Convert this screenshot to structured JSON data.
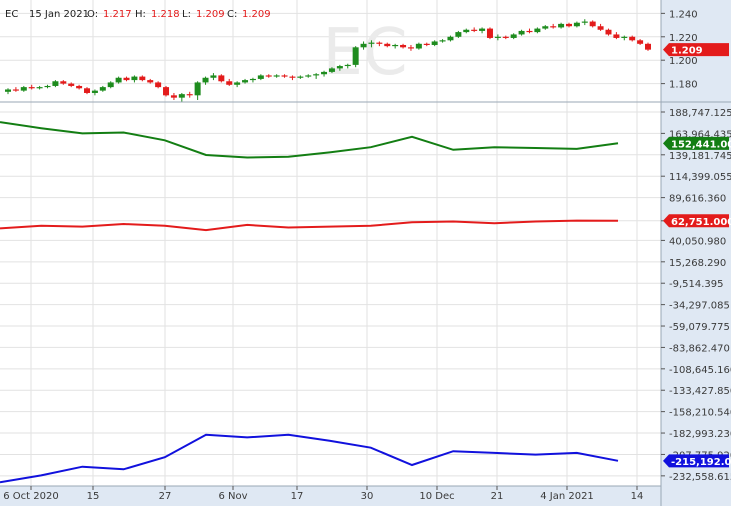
{
  "header": {
    "symbol": "EC",
    "date": "15 Jan 2021",
    "o_label": "O:",
    "o_value": "1.217",
    "h_label": "H:",
    "h_value": "1.218",
    "l_label": "L:",
    "l_value": "1.209",
    "c_label": "C:",
    "c_value": "1.209"
  },
  "watermark": "EC",
  "colors": {
    "up": "#1e8c1e",
    "down": "#e31b1b",
    "cot_commercial": "#137e13",
    "cot_noncommercial": "#e31b1b",
    "cot_small": "#1111dd",
    "axis_panel": "#dfe8f3",
    "grid": "#e2e2e2",
    "border": "#9aa7b5"
  },
  "chart_data": [
    {
      "type": "candlestick",
      "title": "EC",
      "ylim": [
        1.166,
        1.248
      ],
      "y_ticks": [
        "1.240",
        "1.220",
        "1.200",
        "1.180"
      ],
      "last_value_label": "1.209",
      "x_labels": [
        "6 Oct 2020",
        "15",
        "27",
        "6 Nov",
        "17",
        "30",
        "10 Dec",
        "21",
        "4 Jan 2021",
        "14"
      ],
      "ohlc": [
        [
          1.173,
          1.176,
          1.171,
          1.175
        ],
        [
          1.175,
          1.177,
          1.173,
          1.174
        ],
        [
          1.174,
          1.178,
          1.173,
          1.177
        ],
        [
          1.177,
          1.179,
          1.175,
          1.176
        ],
        [
          1.176,
          1.178,
          1.175,
          1.177
        ],
        [
          1.177,
          1.179,
          1.176,
          1.178
        ],
        [
          1.178,
          1.183,
          1.177,
          1.182
        ],
        [
          1.182,
          1.183,
          1.179,
          1.18
        ],
        [
          1.18,
          1.181,
          1.177,
          1.178
        ],
        [
          1.178,
          1.179,
          1.175,
          1.176
        ],
        [
          1.176,
          1.177,
          1.171,
          1.172
        ],
        [
          1.172,
          1.175,
          1.17,
          1.174
        ],
        [
          1.174,
          1.178,
          1.173,
          1.177
        ],
        [
          1.177,
          1.182,
          1.176,
          1.181
        ],
        [
          1.181,
          1.186,
          1.18,
          1.185
        ],
        [
          1.185,
          1.186,
          1.182,
          1.183
        ],
        [
          1.183,
          1.187,
          1.181,
          1.186
        ],
        [
          1.186,
          1.187,
          1.182,
          1.183
        ],
        [
          1.183,
          1.184,
          1.18,
          1.181
        ],
        [
          1.181,
          1.182,
          1.176,
          1.177
        ],
        [
          1.177,
          1.178,
          1.169,
          1.17
        ],
        [
          1.17,
          1.172,
          1.166,
          1.168
        ],
        [
          1.168,
          1.172,
          1.164,
          1.171
        ],
        [
          1.171,
          1.173,
          1.168,
          1.17
        ],
        [
          1.17,
          1.182,
          1.166,
          1.181
        ],
        [
          1.181,
          1.186,
          1.179,
          1.185
        ],
        [
          1.185,
          1.189,
          1.183,
          1.187
        ],
        [
          1.187,
          1.188,
          1.181,
          1.182
        ],
        [
          1.182,
          1.184,
          1.178,
          1.179
        ],
        [
          1.179,
          1.182,
          1.177,
          1.181
        ],
        [
          1.181,
          1.184,
          1.18,
          1.183
        ],
        [
          1.183,
          1.185,
          1.181,
          1.184
        ],
        [
          1.184,
          1.188,
          1.183,
          1.187
        ],
        [
          1.187,
          1.188,
          1.185,
          1.186
        ],
        [
          1.186,
          1.188,
          1.185,
          1.187
        ],
        [
          1.187,
          1.188,
          1.185,
          1.186
        ],
        [
          1.186,
          1.187,
          1.183,
          1.185
        ],
        [
          1.185,
          1.187,
          1.184,
          1.186
        ],
        [
          1.186,
          1.188,
          1.185,
          1.187
        ],
        [
          1.187,
          1.189,
          1.184,
          1.188
        ],
        [
          1.188,
          1.191,
          1.186,
          1.19
        ],
        [
          1.19,
          1.194,
          1.189,
          1.193
        ],
        [
          1.193,
          1.196,
          1.191,
          1.195
        ],
        [
          1.195,
          1.197,
          1.193,
          1.196
        ],
        [
          1.196,
          1.212,
          1.194,
          1.211
        ],
        [
          1.211,
          1.216,
          1.209,
          1.214
        ],
        [
          1.214,
          1.217,
          1.211,
          1.215
        ],
        [
          1.215,
          1.216,
          1.212,
          1.214
        ],
        [
          1.214,
          1.215,
          1.211,
          1.212
        ],
        [
          1.212,
          1.214,
          1.21,
          1.213
        ],
        [
          1.213,
          1.214,
          1.21,
          1.211
        ],
        [
          1.211,
          1.213,
          1.208,
          1.21
        ],
        [
          1.21,
          1.215,
          1.209,
          1.214
        ],
        [
          1.214,
          1.215,
          1.212,
          1.213
        ],
        [
          1.213,
          1.217,
          1.212,
          1.216
        ],
        [
          1.216,
          1.218,
          1.215,
          1.217
        ],
        [
          1.217,
          1.221,
          1.216,
          1.22
        ],
        [
          1.22,
          1.225,
          1.219,
          1.224
        ],
        [
          1.224,
          1.227,
          1.223,
          1.226
        ],
        [
          1.226,
          1.228,
          1.224,
          1.225
        ],
        [
          1.225,
          1.228,
          1.223,
          1.227
        ],
        [
          1.227,
          1.228,
          1.218,
          1.219
        ],
        [
          1.219,
          1.222,
          1.217,
          1.22
        ],
        [
          1.22,
          1.221,
          1.218,
          1.219
        ],
        [
          1.219,
          1.223,
          1.218,
          1.222
        ],
        [
          1.222,
          1.226,
          1.221,
          1.225
        ],
        [
          1.225,
          1.227,
          1.223,
          1.224
        ],
        [
          1.224,
          1.228,
          1.223,
          1.227
        ],
        [
          1.227,
          1.23,
          1.226,
          1.229
        ],
        [
          1.229,
          1.231,
          1.227,
          1.228
        ],
        [
          1.228,
          1.232,
          1.227,
          1.231
        ],
        [
          1.231,
          1.232,
          1.228,
          1.229
        ],
        [
          1.229,
          1.233,
          1.228,
          1.232
        ],
        [
          1.232,
          1.235,
          1.23,
          1.233
        ],
        [
          1.233,
          1.234,
          1.228,
          1.229
        ],
        [
          1.229,
          1.231,
          1.225,
          1.226
        ],
        [
          1.226,
          1.227,
          1.221,
          1.222
        ],
        [
          1.222,
          1.224,
          1.218,
          1.219
        ],
        [
          1.219,
          1.221,
          1.217,
          1.22
        ],
        [
          1.22,
          1.221,
          1.216,
          1.217
        ],
        [
          1.217,
          1.218,
          1.213,
          1.214
        ],
        [
          1.214,
          1.215,
          1.208,
          1.209
        ]
      ]
    },
    {
      "type": "line",
      "title": "",
      "ylim": [
        -242000,
        198000
      ],
      "y_ticks": [
        "188,747.125",
        "163,964.435",
        "139,181.745",
        "114,399.055",
        "89,616.360",
        "62,751.000",
        "40,050.980",
        "15,268.290",
        "-9,514.395",
        "-34,297.085",
        "-59,079.775",
        "-83,862.470",
        "-108,645.160",
        "-133,427.850",
        "-158,210.540",
        "-182,993.230",
        "-207,775.920",
        "-232,558.615"
      ],
      "series": [
        {
          "values": [
            177000,
            170000,
            164000,
            165000,
            156000,
            139000,
            136000,
            137000,
            142000,
            148000,
            160000,
            145000,
            148000,
            147000,
            146000,
            152441
          ],
          "last_value_label": "152,441.000"
        },
        {
          "values": [
            54000,
            57000,
            56000,
            59000,
            57000,
            52000,
            58000,
            55000,
            56000,
            57000,
            61000,
            62000,
            60000,
            62000,
            63000,
            62751
          ],
          "last_value_label": "62,751.000"
        },
        {
          "values": [
            -240000,
            -232000,
            -222000,
            -225000,
            -211000,
            -185000,
            -188000,
            -185000,
            -192000,
            -200000,
            -220000,
            -204000,
            -206000,
            -208000,
            -206000,
            -215192
          ],
          "last_value_label": "-215,192.000"
        }
      ]
    }
  ]
}
